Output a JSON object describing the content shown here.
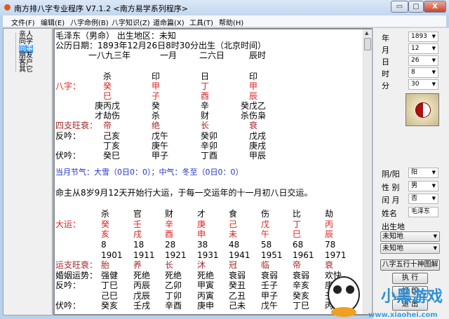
{
  "window": {
    "title": "南方排八字专业程序 V7.1.2  <南方易学系列程序>",
    "min": "▭",
    "max": "▢",
    "close": "X"
  },
  "menu": [
    "文件(F)",
    "编辑(E)",
    "八字命例(B)",
    "八字知识(Z)",
    "道命篇(X)",
    "工具(T)",
    "帮助(H)"
  ],
  "tree": {
    "items": [
      "亲人",
      "同学",
      "同事",
      "朋友",
      "客户",
      "其它"
    ],
    "selected": 2
  },
  "header": {
    "line1": "毛泽东（男命）  出生地区：未知",
    "line2": "公历日期：1893年12月26日8时30分出生（北京时间）",
    "dates": [
      "一八九三年",
      "一月",
      "二六日",
      "辰时"
    ]
  },
  "pillars": {
    "gods": [
      "杀",
      "印",
      "日",
      "印"
    ],
    "bazi_label": "八字：",
    "stems": [
      "癸",
      "甲",
      "丁",
      "甲"
    ],
    "branches": [
      "巳",
      "子",
      "酉",
      "辰"
    ],
    "hidden": [
      "庚丙戊",
      "癸",
      "辛",
      "癸戊乙"
    ],
    "hidden_gods": [
      "才劫伤",
      "杀",
      "财",
      "杀伤枭"
    ],
    "wangshuai_label": "四支旺衰：",
    "wangshuai": [
      "帝",
      "绝",
      "长",
      "衰"
    ],
    "fanyin_label": "反吟：",
    "fanyin1": [
      "己亥",
      "戊午",
      "癸卯",
      "戊戌"
    ],
    "fanyin2": [
      "丁亥",
      "庚午",
      "辛卯",
      "庚戌"
    ],
    "fuyin_label": "伏吟：",
    "fuyin": [
      "癸巳",
      "甲子",
      "丁酉",
      "甲辰"
    ]
  },
  "jieqi": "当月节气：大雪（0日0：0）；中气：冬至（0日0：0）",
  "qiyun": "命主从8岁9月12天开始行大运，于每一交运年的十一月初八日交运。",
  "dayun": {
    "gods": [
      "杀",
      "官",
      "财",
      "才",
      "食",
      "伤",
      "比",
      "劫"
    ],
    "label": "大运：",
    "stems": [
      "癸",
      "壬",
      "辛",
      "庚",
      "己",
      "戊",
      "丁",
      "丙"
    ],
    "branches": [
      "亥",
      "戌",
      "酉",
      "申",
      "未",
      "午",
      "巳",
      "辰"
    ],
    "ages": [
      "8",
      "18",
      "28",
      "38",
      "48",
      "58",
      "68",
      "78"
    ],
    "years": [
      "1901",
      "1911",
      "1921",
      "1931",
      "1941",
      "1951",
      "1961",
      "1971"
    ],
    "ws_label": "运支旺衰：",
    "wangshuai": [
      "胎",
      "养",
      "长",
      "沐",
      "冠",
      "临",
      "帝",
      "衰"
    ],
    "marriage_label": "婚姻运势：",
    "marriage": [
      "强健",
      "死绝",
      "死绝",
      "死绝",
      "衰弱",
      "衰弱",
      "衰弱",
      "欢快"
    ],
    "fanyin_label": "反吟：",
    "fanyin1": [
      "丁巳",
      "丙辰",
      "乙卯",
      "甲寅",
      "癸丑",
      "壬子",
      "辛亥",
      "庚戌"
    ],
    "fanyin2": [
      "己巳",
      "戊辰",
      "丁卯",
      "丙寅",
      "乙丑",
      "甲子",
      "癸亥",
      "壬戌"
    ],
    "fuyin_label": "伏吟：",
    "fuyin": [
      "癸亥",
      "壬戌",
      "辛酉",
      "庚申",
      "己未",
      "戊午",
      "丁巳",
      "丙辰"
    ]
  },
  "side": {
    "fields": [
      {
        "label": "年",
        "value": "1893"
      },
      {
        "label": "月",
        "value": "12"
      },
      {
        "label": "日",
        "value": "26"
      },
      {
        "label": "时",
        "value": "8"
      },
      {
        "label": "分",
        "value": "30"
      }
    ],
    "yinyang": {
      "label": "阴/阳",
      "value": "阳"
    },
    "gender": {
      "label": "性 别",
      "value": "男"
    },
    "leap": {
      "label": "闰 月",
      "value": "否"
    },
    "name": {
      "label": "姓名",
      "value": "毛泽东"
    },
    "birthplace_label": "出生地",
    "place1": "未知地",
    "place2": "未知地",
    "diagram_btn": "八字五行十神图解",
    "run_btn": "执  行",
    "print_btn": "打  印",
    "exit_btn": "退  出"
  },
  "watermark": {
    "brand": "小黑游戏",
    "url": "www.xiaohei.com"
  }
}
